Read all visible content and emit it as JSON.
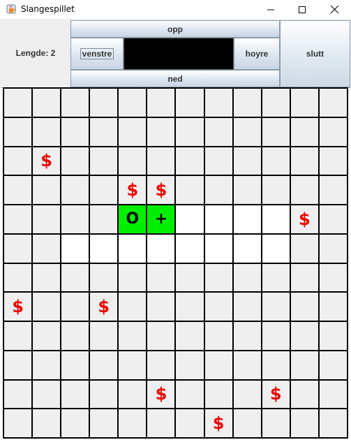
{
  "window": {
    "title": "Slangespillet",
    "icon": "java-cup-icon",
    "controls": [
      "minimize-icon",
      "maximize-icon",
      "close-icon"
    ]
  },
  "panel": {
    "length_label": "Lengde: 2",
    "buttons": {
      "up": "opp",
      "down": "ned",
      "left": "venstre",
      "right": "hoyre",
      "quit": "slutt"
    }
  },
  "board": {
    "rows": 12,
    "cols": 12,
    "symbols": {
      "food": "$",
      "head": "O",
      "body": "+"
    },
    "colors": {
      "snake": "#00ee00",
      "food": "#ee0000",
      "visited": "#ffffff",
      "empty": "#efefef"
    },
    "cells": [
      [
        "",
        "",
        "",
        "",
        "",
        "",
        "",
        "",
        "",
        "",
        "",
        ""
      ],
      [
        "",
        "",
        "",
        "",
        "",
        "",
        "",
        "",
        "",
        "",
        "",
        ""
      ],
      [
        "",
        "$",
        "",
        "",
        "",
        "",
        "",
        "",
        "",
        "",
        "",
        ""
      ],
      [
        "",
        "",
        "",
        "",
        "$",
        "$",
        "",
        "",
        "",
        "",
        "",
        ""
      ],
      [
        "",
        "",
        "",
        "",
        "O",
        "+",
        "w",
        "w",
        "w",
        "w",
        "$",
        ""
      ],
      [
        "",
        "",
        "w",
        "w",
        "w",
        "w",
        "w",
        "w",
        "w",
        "w",
        "",
        ""
      ],
      [
        "",
        "",
        "",
        "",
        "",
        "",
        "",
        "",
        "",
        "",
        "",
        ""
      ],
      [
        "$",
        "",
        "",
        "$",
        "",
        "",
        "",
        "",
        "",
        "",
        "",
        ""
      ],
      [
        "",
        "",
        "",
        "",
        "",
        "",
        "",
        "",
        "",
        "",
        "",
        ""
      ],
      [
        "",
        "",
        "",
        "",
        "",
        "",
        "",
        "",
        "",
        "",
        "",
        ""
      ],
      [
        "",
        "",
        "",
        "",
        "",
        "$",
        "",
        "",
        "",
        "$",
        "",
        ""
      ],
      [
        "",
        "",
        "",
        "",
        "",
        "",
        "",
        "$",
        "",
        "",
        "",
        ""
      ]
    ]
  }
}
